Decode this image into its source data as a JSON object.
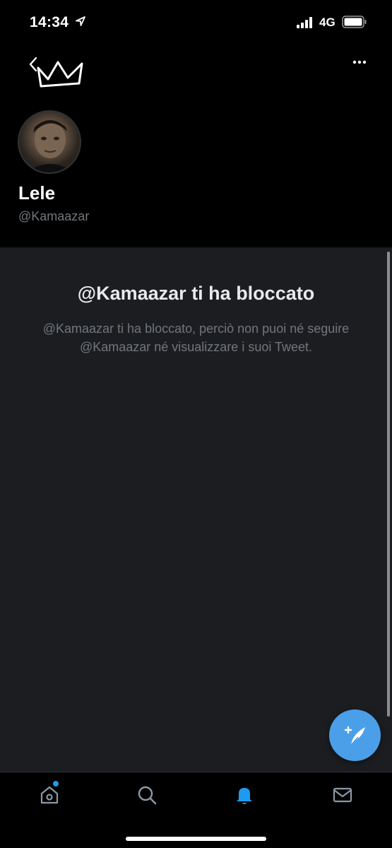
{
  "status_bar": {
    "time": "14:34",
    "network": "4G"
  },
  "profile": {
    "display_name": "Lele",
    "handle": "@Kamaazar"
  },
  "blocked": {
    "title": "@Kamaazar ti ha bloccato",
    "message": "@Kamaazar ti ha bloccato, perciò non puoi né seguire @Kamaazar né visualizzare i suoi Tweet."
  },
  "icons": {
    "back": "chevron-left-icon",
    "more": "more-horizontal-icon",
    "compose": "compose-tweet-icon",
    "home": "home-icon",
    "search": "search-icon",
    "notifications": "bell-icon",
    "messages": "mail-icon"
  },
  "colors": {
    "accent": "#1d9bf0",
    "fab": "#4a9fe8",
    "panel_bg": "#1c1d21",
    "muted_text": "#71767b"
  },
  "tabs": {
    "active": "notifications",
    "home_has_new": true
  }
}
